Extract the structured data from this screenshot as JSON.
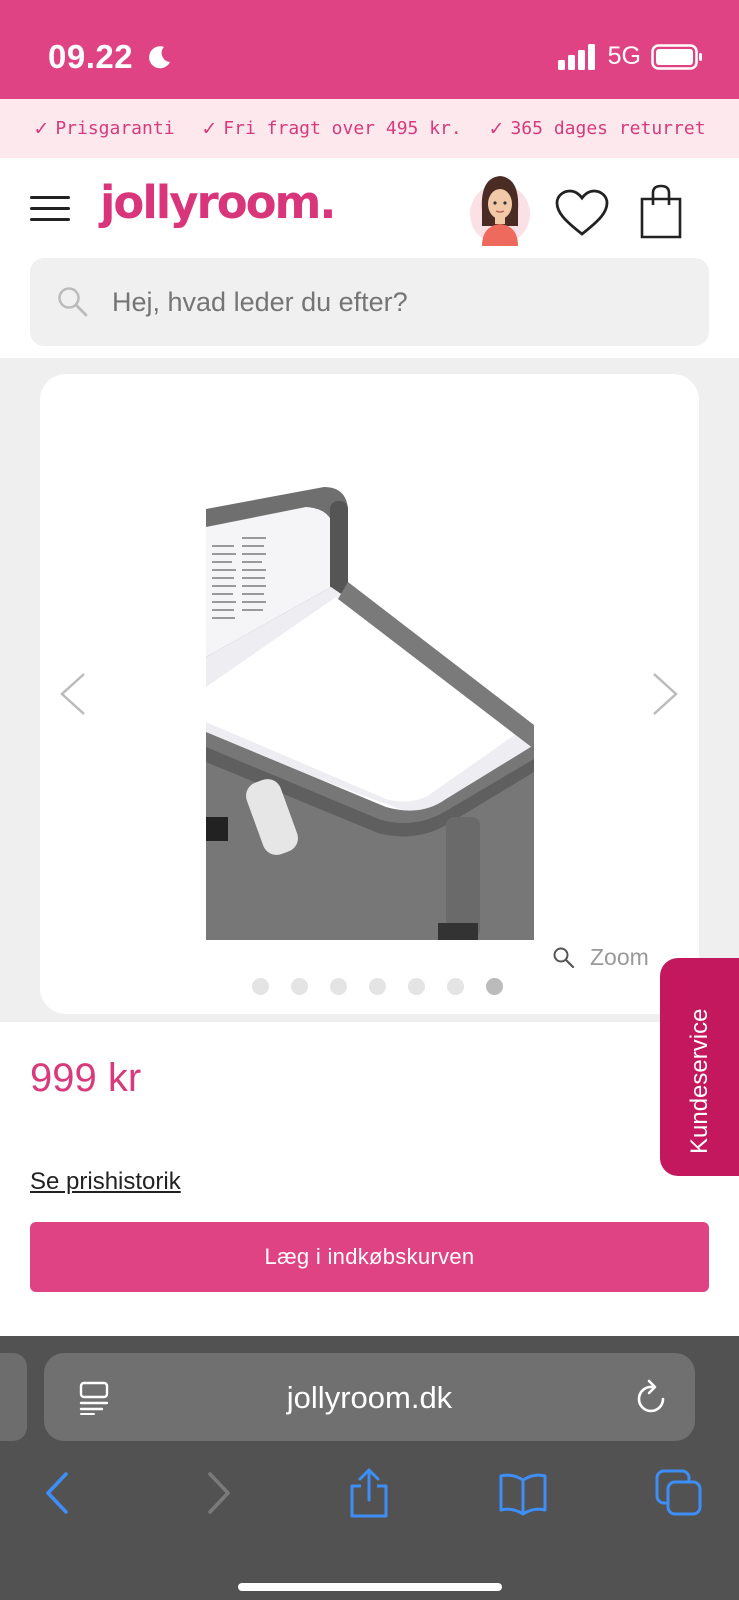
{
  "status_bar": {
    "time": "09.22",
    "network": "5G",
    "moon_icon": "moon-icon",
    "signal_icon": "signal-bars-icon",
    "battery_icon": "battery-icon"
  },
  "usp": [
    {
      "icon": "check-icon",
      "label": "Prisgaranti"
    },
    {
      "icon": "check-icon",
      "label": "Fri fragt over 495 kr."
    },
    {
      "icon": "check-icon",
      "label": "365 dages returret"
    }
  ],
  "header": {
    "logo": "jollyroom.",
    "menu_icon": "hamburger-menu-icon",
    "avatar_icon": "assistant-avatar",
    "wishlist_icon": "heart-icon",
    "cart_icon": "shopping-bag-icon"
  },
  "search": {
    "placeholder": "Hej, hvad leder du efter?",
    "icon": "search-icon"
  },
  "gallery": {
    "zoom_label": "Zoom",
    "dot_count": 7,
    "active_dot": 7
  },
  "product": {
    "price": "999 kr",
    "price_history_link": "Se prishistorik",
    "add_to_cart_label": "Læg i indkøbskurven"
  },
  "customer_service": {
    "label": "Kundeservice"
  },
  "browser": {
    "url": "jollyroom.dk",
    "reader_icon": "reader-mode-icon",
    "reload_icon": "reload-icon",
    "toolbar": [
      "back-icon",
      "forward-icon",
      "share-icon",
      "bookmarks-icon",
      "tabs-icon"
    ]
  },
  "colors": {
    "brand_pink": "#e04383",
    "usp_bg": "#fde8ee",
    "customer_service_bg": "#c3185d",
    "browser_bg": "#525252",
    "ios_blue": "#3d8ef7"
  }
}
